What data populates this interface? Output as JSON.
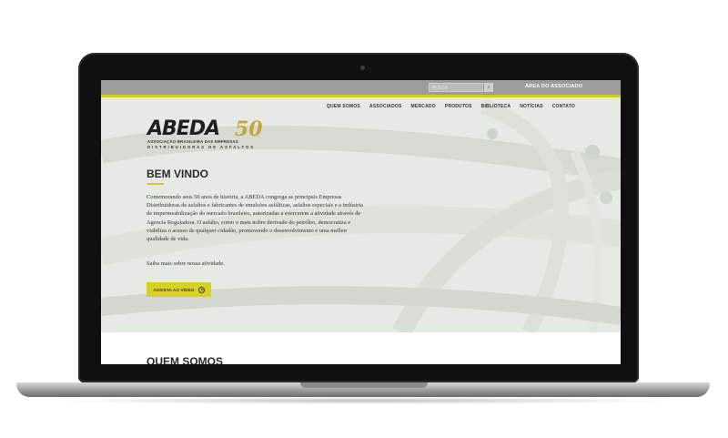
{
  "topbar": {
    "search_placeholder": "BUSCA",
    "area_label": "ÁREA DO ASSOCIADO"
  },
  "nav": {
    "items": [
      "QUEM SOMOS",
      "ASSOCIADOS",
      "MERCADO",
      "PRODUTOS",
      "BIBLIOTECA",
      "NOTÍCIAS",
      "CONTATO"
    ]
  },
  "logo": {
    "name": "ABEDA",
    "anniversary": "50",
    "line1": "ASSOCIAÇÃO BRASILEIRA DAS EMPRESAS",
    "line2": "DISTRIBUIDORAS DE ASFALTOS"
  },
  "hero": {
    "title": "BEM VINDO",
    "intro": "Comemorando seus 50 anos de história, a ABEDA congrega as principais Empresas Distribuidoras de asfaltos e fabricantes de emulsões asfálticas, asfaltos especiais e a indústria de impermeabilização do mercado brasileiro, autorizadas a exercerem a atividade através de Agencia Reguladora. O asfalto, como o mais nobre derivado do petróleo, democratiza e viabiliza o acesso de qualquer cidadão, promovendo o desenvolvimento e uma melhor qualidade de vida.",
    "more": "Saiba mais sobre nossa atividade.",
    "video_button": "ASSISTA AO VÍDEO"
  },
  "next_section": {
    "title": "QUEM SOMOS"
  },
  "colors": {
    "accent": "#d8d024",
    "topbar": "#9c9c9c",
    "gold": "#c9a437"
  }
}
